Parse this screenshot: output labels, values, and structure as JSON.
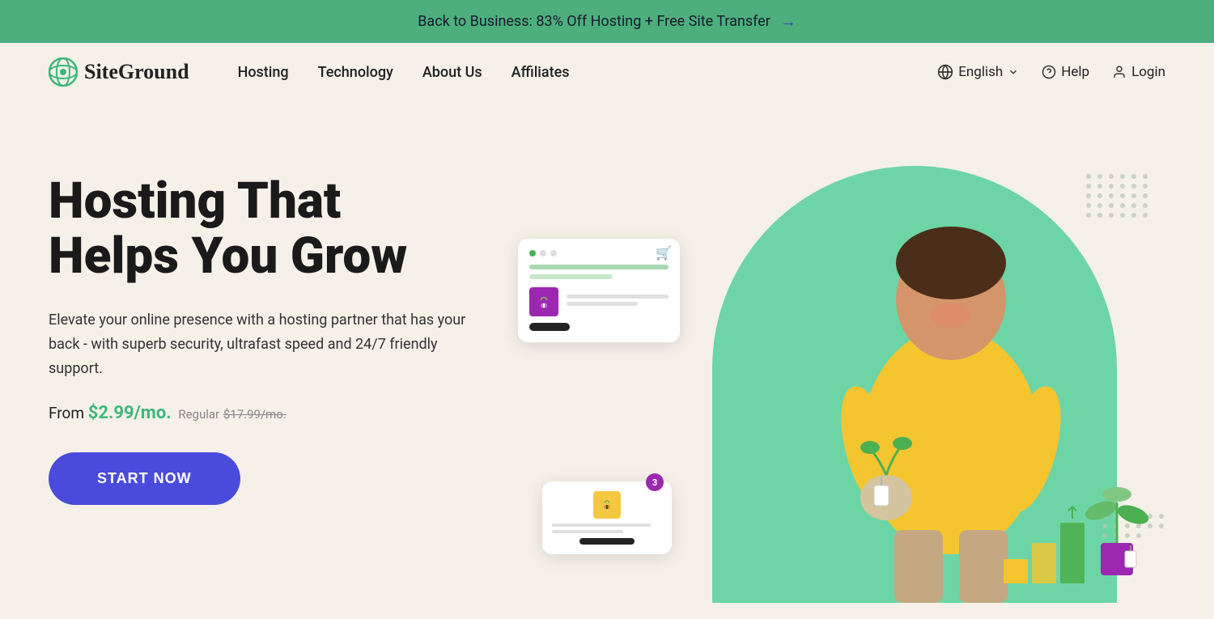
{
  "banner": {
    "text": "Back to Business: 83% Off Hosting + Free Site Transfer",
    "arrow": "→"
  },
  "navbar": {
    "logo_text": "SiteGround",
    "nav_items": [
      {
        "label": "Hosting",
        "id": "hosting"
      },
      {
        "label": "Technology",
        "id": "technology"
      },
      {
        "label": "About Us",
        "id": "about-us"
      },
      {
        "label": "Affiliates",
        "id": "affiliates"
      }
    ],
    "language": "English",
    "help": "Help",
    "login": "Login"
  },
  "hero": {
    "title_line1": "Hosting That",
    "title_line2": "Helps You Grow",
    "subtitle": "Elevate your online presence with a hosting partner that has your back - with superb security, ultrafast speed and 24/7 friendly support.",
    "price_from": "From ",
    "price_value": "$2.99",
    "price_per": "/mo.",
    "price_regular_label": "Regular",
    "price_regular_value": "$17.99/mo.",
    "cta_button": "START NOW"
  }
}
